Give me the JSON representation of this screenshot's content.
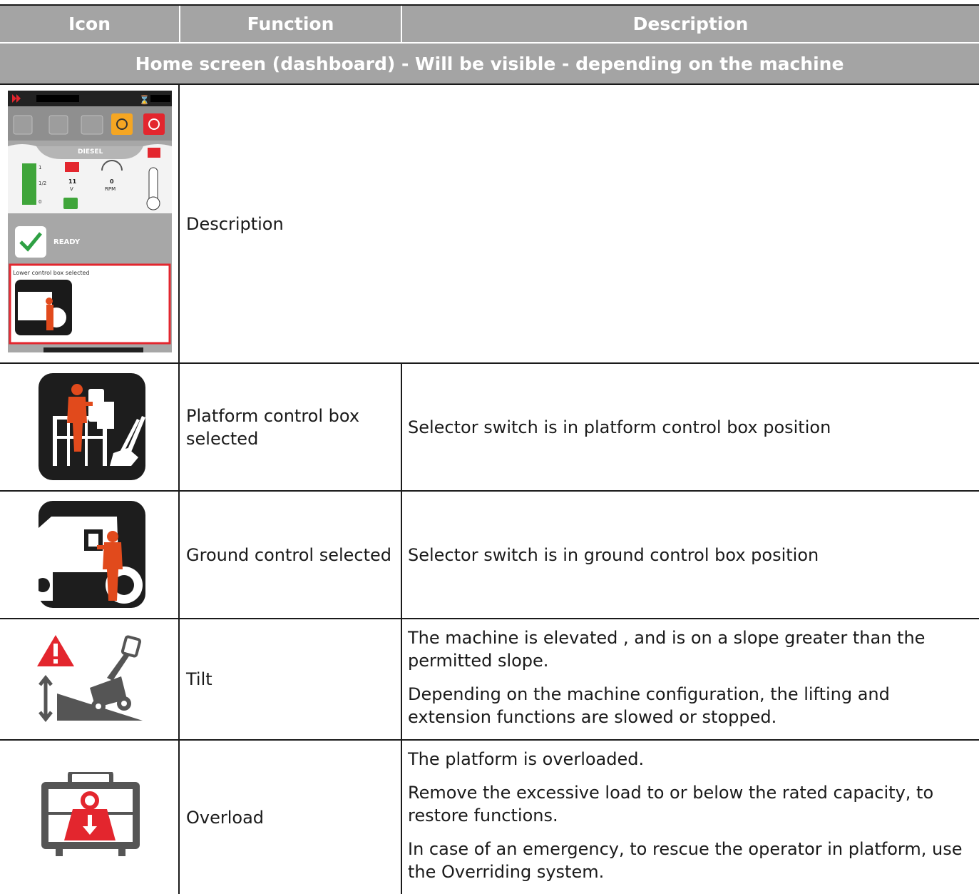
{
  "table": {
    "headers": [
      "Icon",
      "Function",
      "Description"
    ],
    "section_title": "Home screen (dashboard)  -  Will be visible - depending on the machine",
    "rows": [
      {
        "icon": "dashboard-screen-icon",
        "function": "Description",
        "description": []
      },
      {
        "icon": "platform-control-box-icon",
        "function": "Platform control box selected",
        "description": [
          "Selector switch is in platform control box position"
        ]
      },
      {
        "icon": "ground-control-icon",
        "function": "Ground control selected",
        "description": [
          "Selector switch is in ground control box position"
        ]
      },
      {
        "icon": "tilt-warning-icon",
        "function": "Tilt",
        "description": [
          "The machine is elevated , and is on a slope greater than the permitted slope.",
          "Depending on the machine configuration, the lifting and extension functions are slowed or stopped."
        ]
      },
      {
        "icon": "overload-icon",
        "function": "Overload",
        "description": [
          "The platform is overloaded.",
          "Remove the excessive load to or below the rated capacity, to restore functions.",
          "In case of an emergency, to rescue the operator in platform, use the Overriding system."
        ]
      }
    ]
  },
  "dashboard": {
    "fuel_label": "DIESEL",
    "fuel_levels": [
      "1",
      "1/2",
      "0"
    ],
    "voltage_value": "11",
    "voltage_unit": "V",
    "rpm_value": "0",
    "rpm_unit": "RPM",
    "status": "READY",
    "control_caption": "Lower control box selected"
  },
  "colors": {
    "header_bg": "#a4a4a4",
    "accent_red": "#e3262e",
    "worker_orange": "#e14a1c",
    "warning_yellow": "#f5a623",
    "ok_green": "#2ea043"
  }
}
